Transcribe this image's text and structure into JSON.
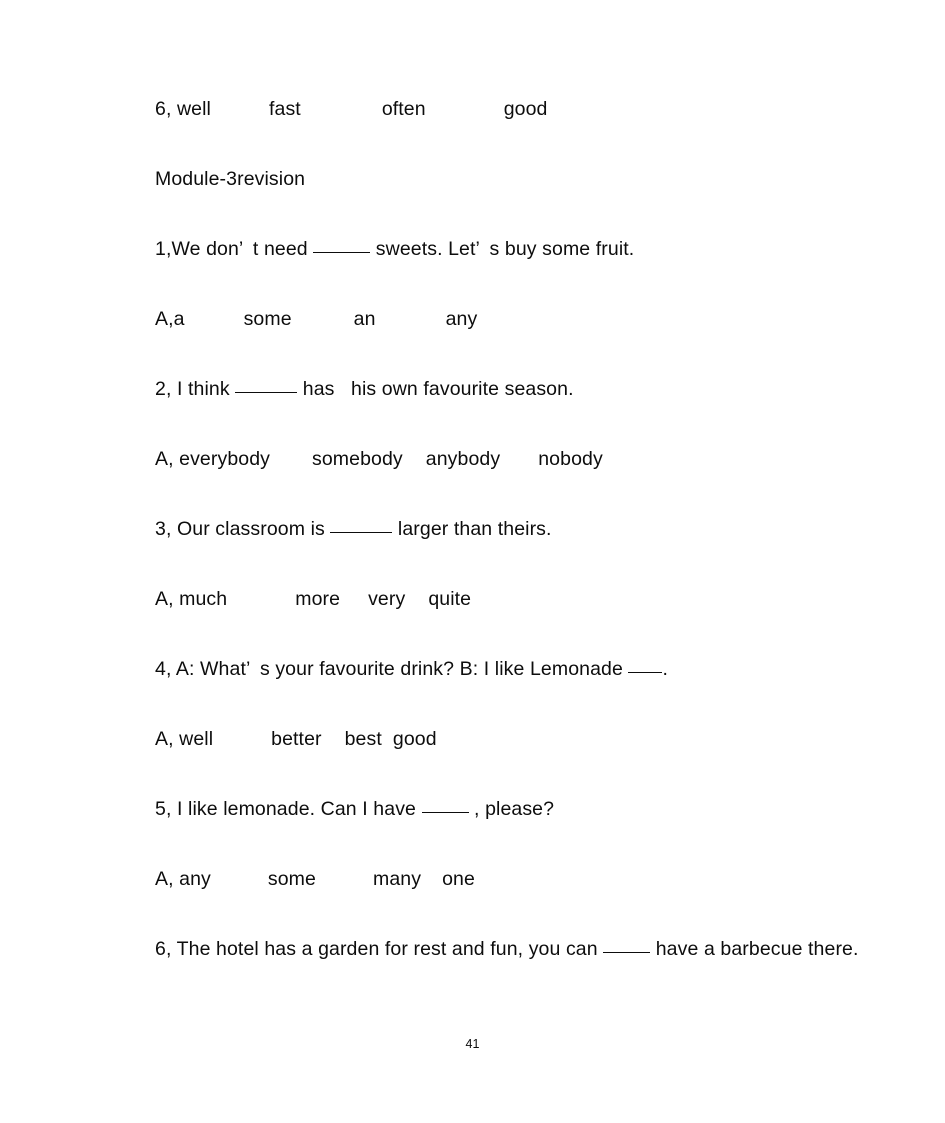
{
  "page": {
    "page_number": "41",
    "background_color": "#ffffff",
    "text_color": "#0d0d0d"
  },
  "heading": {
    "text": "Module-3revision"
  },
  "lines": [
    {
      "kind": "options",
      "label": "6, well",
      "choices": [
        "fast",
        "often",
        "good"
      ],
      "offsets": [
        100,
        195,
        320
      ]
    }
  ],
  "content": {
    "prev_options": {
      "label": "6, well",
      "choice_1": "fast",
      "choice_2": "often",
      "choice_3": "good"
    },
    "q1": {
      "number": "1,",
      "text_before": "We don",
      "apostrophe": "’",
      "text_mid": "t need ",
      "text_after": " sweets. Let",
      "apostrophe2": "’",
      "text_end": "s buy some fruit."
    },
    "q1_options": {
      "label": "A,a",
      "choice_1": "some",
      "choice_2": "an",
      "choice_3": "any"
    },
    "q2": {
      "text_before": "2, I think ",
      "text_after": " has   his own favourite season."
    },
    "q2_options": {
      "label": "A, everybody",
      "choice_1": "somebody",
      "choice_2": "anybody",
      "choice_3": "nobody"
    },
    "q3": {
      "text_before": "3, Our classroom is ",
      "text_after": " larger than theirs."
    },
    "q3_options": {
      "label": "A, much",
      "choice_1": "more",
      "choice_2": "very",
      "choice_3": "quite"
    },
    "q4": {
      "text_before": "4, A: What",
      "apostrophe": "’",
      "text_after": "s your favourite drink? B: I like Lemonade ",
      "text_end": "."
    },
    "q4_options": {
      "label": "A, well",
      "choice_1": "better",
      "choice_2": "best",
      "choice_3": "good"
    },
    "q5": {
      "text_before": "5, I like lemonade. Can I have ",
      "text_after": " , please?"
    },
    "q5_options": {
      "label": "A, any",
      "choice_1": "some",
      "choice_2": "many",
      "choice_3": "one"
    },
    "q6": {
      "text_before": "6, The hotel has a garden for rest and fun, you can ",
      "text_after": " have a barbecue there."
    }
  }
}
